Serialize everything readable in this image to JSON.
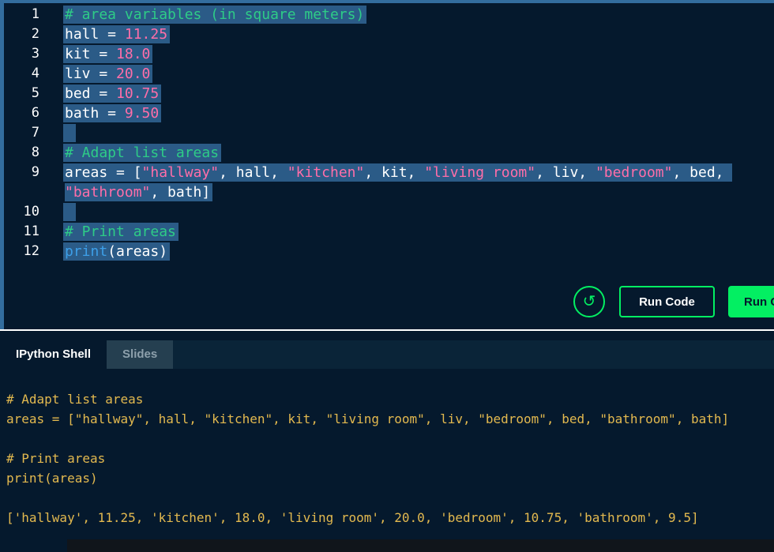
{
  "colors": {
    "editor_background": "#05192d",
    "selection_blue": "#2b5b87",
    "comment_green": "#2ecc87",
    "number_string_pink": "#ff6ea9",
    "function_blue": "#3d9fe8",
    "accent_green": "#03ef62",
    "shell_text_gold": "#e3b94f"
  },
  "editor": {
    "lines": [
      {
        "n": "1",
        "sel": true,
        "tokens": [
          {
            "t": "# area variables (in square meters)",
            "c": "com"
          }
        ]
      },
      {
        "n": "2",
        "sel": true,
        "tokens": [
          {
            "t": "hall = ",
            "c": "plain"
          },
          {
            "t": "11.25",
            "c": "num"
          }
        ]
      },
      {
        "n": "3",
        "sel": true,
        "tokens": [
          {
            "t": "kit = ",
            "c": "plain"
          },
          {
            "t": "18.0",
            "c": "num"
          }
        ]
      },
      {
        "n": "4",
        "sel": true,
        "tokens": [
          {
            "t": "liv = ",
            "c": "plain"
          },
          {
            "t": "20.0",
            "c": "num"
          }
        ]
      },
      {
        "n": "5",
        "sel": true,
        "tokens": [
          {
            "t": "bed = ",
            "c": "plain"
          },
          {
            "t": "10.75",
            "c": "num"
          }
        ]
      },
      {
        "n": "6",
        "sel": true,
        "tokens": [
          {
            "t": "bath = ",
            "c": "plain"
          },
          {
            "t": "9.50",
            "c": "num"
          }
        ]
      },
      {
        "n": "7",
        "sel": true,
        "tokens": []
      },
      {
        "n": "8",
        "sel": true,
        "tokens": [
          {
            "t": "# Adapt list areas",
            "c": "com"
          }
        ]
      },
      {
        "n": "9",
        "sel": true,
        "tokens": [
          {
            "t": "areas = [",
            "c": "plain"
          },
          {
            "t": "\"hallway\"",
            "c": "str"
          },
          {
            "t": ", hall, ",
            "c": "plain"
          },
          {
            "t": "\"kitchen\"",
            "c": "str"
          },
          {
            "t": ", kit, ",
            "c": "plain"
          },
          {
            "t": "\"living room\"",
            "c": "str"
          },
          {
            "t": ", liv, ",
            "c": "plain"
          },
          {
            "t": "\"bedroom\"",
            "c": "str"
          },
          {
            "t": ", bed, ",
            "c": "plain"
          },
          {
            "t": "\"bathroom\"",
            "c": "str"
          },
          {
            "t": ", bath]",
            "c": "plain"
          }
        ]
      },
      {
        "n": "10",
        "sel": true,
        "tokens": []
      },
      {
        "n": "11",
        "sel": true,
        "tokens": [
          {
            "t": "# Print areas",
            "c": "com"
          }
        ]
      },
      {
        "n": "12",
        "sel": true,
        "tokens": [
          {
            "t": "print",
            "c": "fn"
          },
          {
            "t": "(areas)",
            "c": "plain"
          }
        ]
      }
    ]
  },
  "actions": {
    "reset_icon": "↺",
    "run_code_label": "Run Code",
    "submit_label": "Run Code"
  },
  "shell": {
    "tabs": [
      {
        "label": "IPython Shell"
      },
      {
        "label": "Slides"
      }
    ],
    "output_lines": [
      "# Adapt list areas",
      "areas = [\"hallway\", hall, \"kitchen\", kit, \"living room\", liv, \"bedroom\", bed, \"bathroom\", bath]",
      "",
      "# Print areas",
      "print(areas)",
      "",
      "['hallway', 11.25, 'kitchen', 18.0, 'living room', 20.0, 'bedroom', 10.75, 'bathroom', 9.5]"
    ]
  }
}
